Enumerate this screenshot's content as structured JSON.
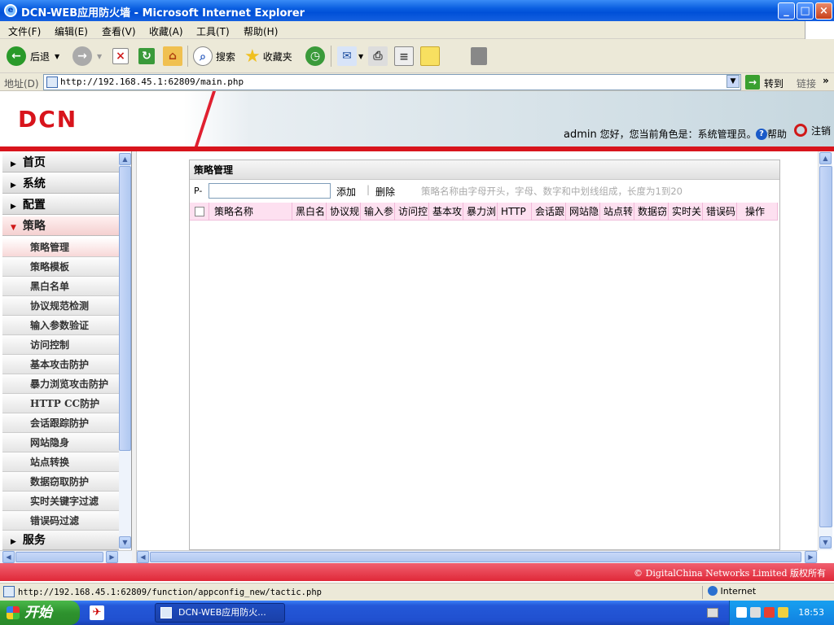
{
  "window": {
    "title": "DCN-WEB应用防火墙 - Microsoft Internet Explorer",
    "minimize": "_",
    "maximize": "□",
    "close": "×"
  },
  "menubar": [
    "文件(F)",
    "编辑(E)",
    "查看(V)",
    "收藏(A)",
    "工具(T)",
    "帮助(H)"
  ],
  "toolbar": {
    "back": "后退",
    "search": "搜索",
    "favorites": "收藏夹"
  },
  "address": {
    "label": "地址(D)",
    "url": "http://192.168.45.1:62809/main.php",
    "go": "转到",
    "links": "链接"
  },
  "header": {
    "logo": "DCN",
    "user": "admin",
    "greeting": "您好，您当前角色是：系统管理员。",
    "help": "帮助",
    "logout": "注销"
  },
  "sidebar": {
    "categories": [
      {
        "label": "首页",
        "expanded": false
      },
      {
        "label": "系统",
        "expanded": false
      },
      {
        "label": "配置",
        "expanded": false
      },
      {
        "label": "策略",
        "expanded": true
      },
      {
        "label": "服务",
        "expanded": false
      }
    ],
    "items": [
      "策略管理",
      "策略模板",
      "黑白名单",
      "协议规范检测",
      "输入参数验证",
      "访问控制",
      "基本攻击防护",
      "暴力浏览攻击防护",
      "HTTP CC防护",
      "会话跟踪防护",
      "网站隐身",
      "站点转换",
      "数据窃取防护",
      "实时关键字过滤",
      "错误码过滤"
    ],
    "selected_item": "策略管理"
  },
  "panel": {
    "title": "策略管理",
    "prefix": "P-",
    "input_value": "",
    "add": "添加",
    "delete": "删除",
    "hint": "策略名称由字母开头，字母、数字和中划线组成，长度为1到20",
    "columns": [
      "策略名称",
      "黑白名",
      "协议规",
      "输入参",
      "访问控",
      "基本攻",
      "暴力浏",
      "HTTP",
      "会话跟",
      "网站隐",
      "站点转",
      "数据窃",
      "实时关",
      "错误码",
      "操作"
    ],
    "rows": []
  },
  "footer": {
    "copyright": "© DigitalChina Networks Limited 版权所有"
  },
  "statusbar": {
    "url": "http://192.168.45.1:62809/function/appconfig_new/tactic.php",
    "zone": "Internet"
  },
  "taskbar": {
    "start": "开始",
    "window_button": "DCN-WEB应用防火...",
    "clock": "18:53"
  }
}
